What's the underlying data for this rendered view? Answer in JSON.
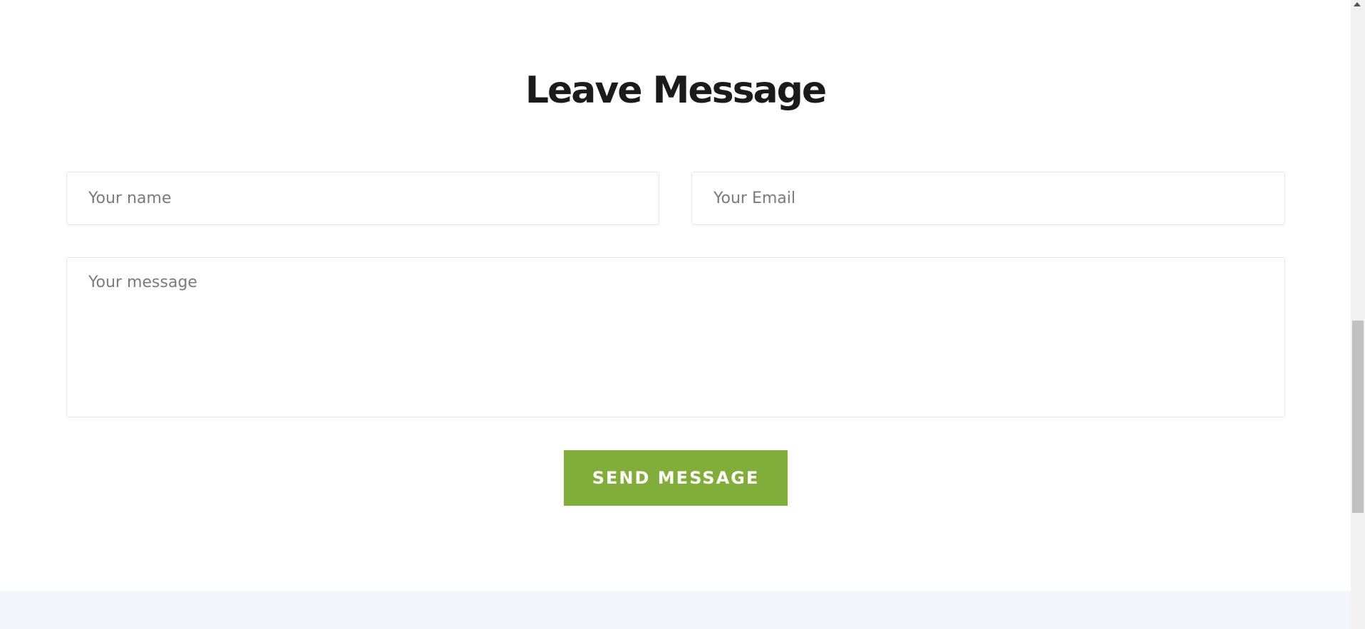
{
  "section": {
    "heading": "Leave Message"
  },
  "form": {
    "name_placeholder": "Your name",
    "email_placeholder": "Your Email",
    "message_placeholder": "Your message",
    "submit_label": "SEND MESSAGE"
  },
  "colors": {
    "accent": "#81ad3b",
    "heading_text": "#1b1b1b",
    "footer_band": "#f2f5f9"
  },
  "icons": {
    "scroll_up": "scroll-up-arrow-icon"
  }
}
